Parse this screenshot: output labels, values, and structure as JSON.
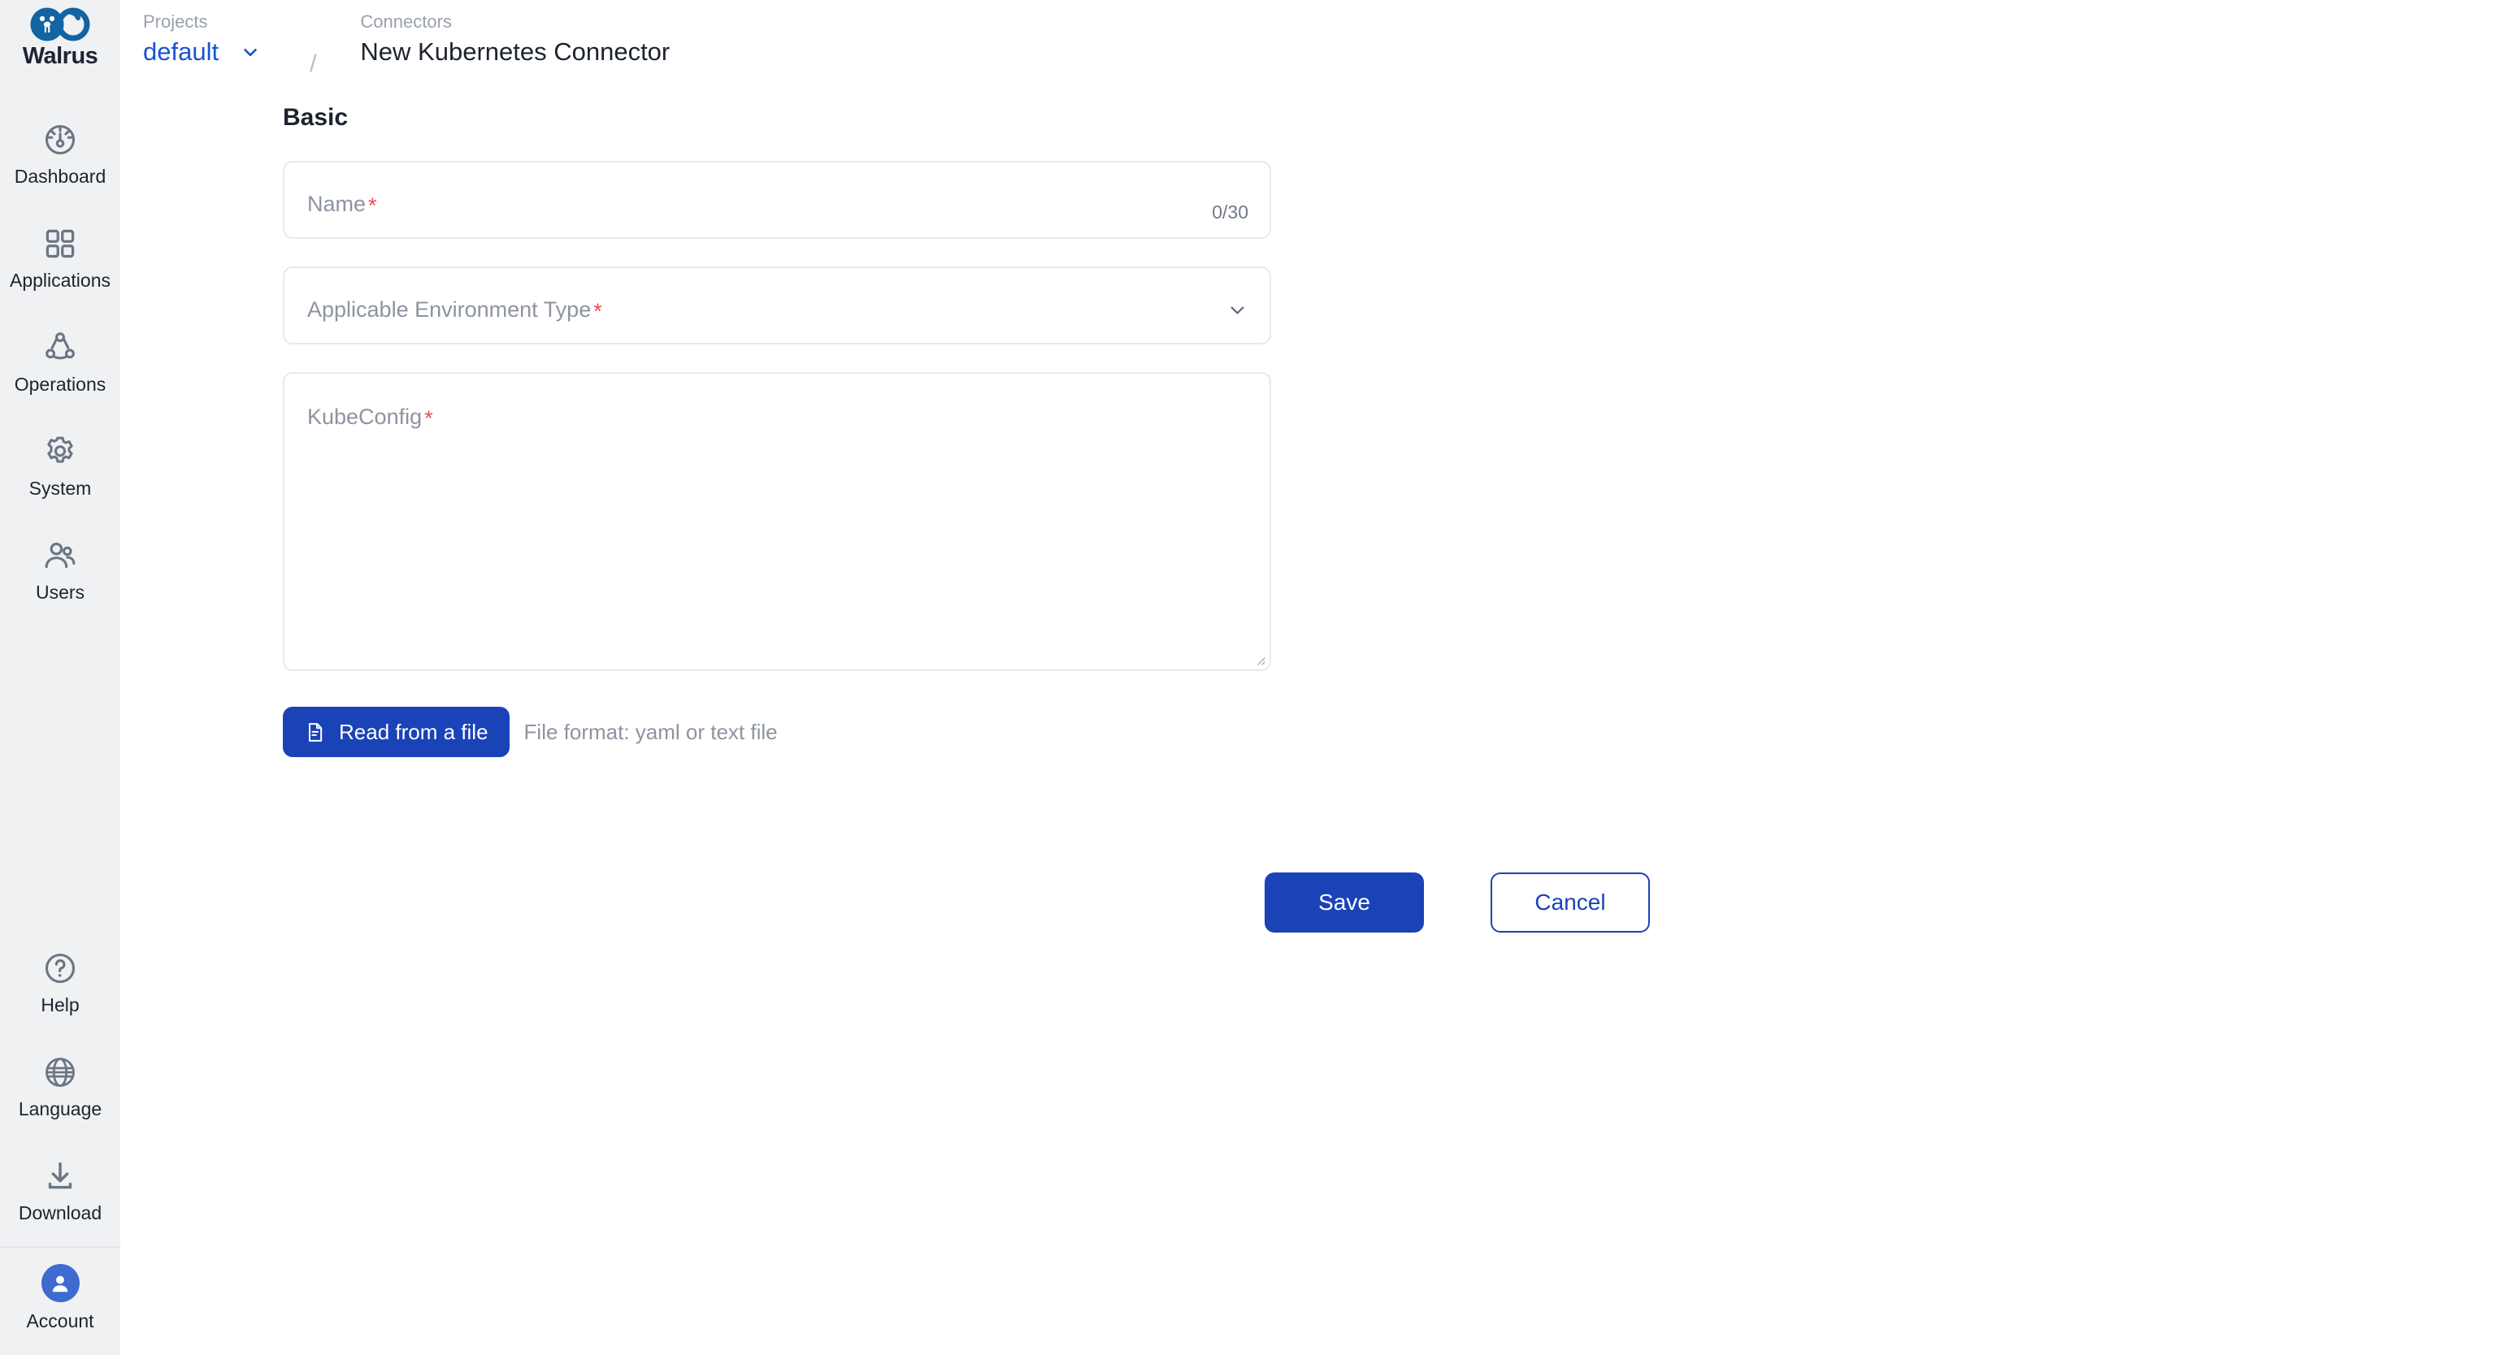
{
  "brand": {
    "name": "Walrus",
    "logo_icon": "walrus-infinity-logo",
    "color": "#1264a3"
  },
  "sidebar": {
    "top_items": [
      {
        "label": "Dashboard",
        "icon": "dashboard-gauge-icon"
      },
      {
        "label": "Applications",
        "icon": "grid-squares-icon"
      },
      {
        "label": "Operations",
        "icon": "operations-nodes-icon"
      },
      {
        "label": "System",
        "icon": "gear-icon"
      },
      {
        "label": "Users",
        "icon": "users-icon"
      }
    ],
    "bottom_items": [
      {
        "label": "Help",
        "icon": "question-circle-icon"
      },
      {
        "label": "Language",
        "icon": "globe-icon"
      },
      {
        "label": "Download",
        "icon": "download-icon"
      }
    ],
    "account": {
      "label": "Account",
      "icon": "user-avatar-icon",
      "avatar_color": "#3f6ad0"
    }
  },
  "breadcrumb": {
    "projects_caption": "Projects",
    "project_value": "default",
    "separator": "/",
    "connectors_caption": "Connectors",
    "current": "New Kubernetes Connector",
    "link_color": "#1a52d4"
  },
  "content": {
    "section_title": "Basic",
    "fields": {
      "name": {
        "label": "Name",
        "required_mark": "*",
        "value": "",
        "counter": "0/30"
      },
      "environment_type": {
        "label": "Applicable Environment Type",
        "required_mark": "*",
        "value": "",
        "caret_icon": "chevron-down-icon"
      },
      "kubeconfig": {
        "label": "KubeConfig",
        "required_mark": "*",
        "value": ""
      }
    },
    "file_row": {
      "button_label": "Read from a file",
      "button_icon": "file-document-icon",
      "hint": "File format: yaml or text file"
    },
    "actions": {
      "save_label": "Save",
      "cancel_label": "Cancel",
      "primary_color": "#1a43b8"
    }
  }
}
